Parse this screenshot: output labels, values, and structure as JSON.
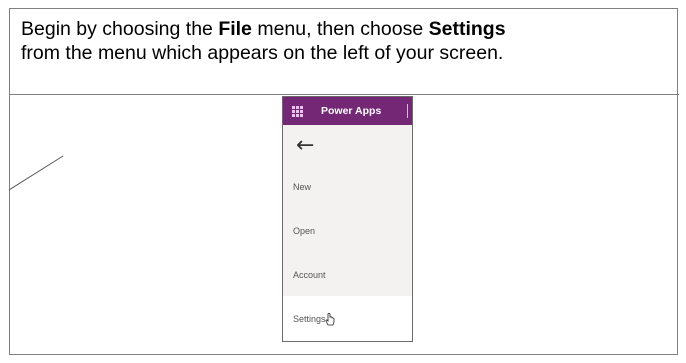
{
  "instructions": {
    "line1_pre": "Begin by choosing the ",
    "line1_bold1": "File",
    "line1_mid": " menu, then choose ",
    "line1_bold2": "Settings",
    "line2": "from the menu which appears on the left of your screen."
  },
  "screenshot": {
    "app_name": "Power Apps",
    "back_glyph": "←",
    "menu_items": [
      "New",
      "Open",
      "Account",
      "Settings"
    ],
    "selected_item": "Settings",
    "header_color": "#742774"
  }
}
